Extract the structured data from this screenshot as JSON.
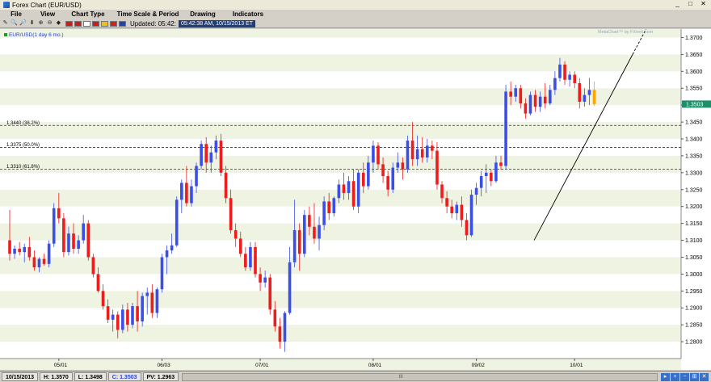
{
  "window": {
    "title": "Forex Chart (EUR/USD)",
    "buttons": [
      "_",
      "□",
      "✕"
    ]
  },
  "menu": [
    {
      "label": "File",
      "w": 40
    },
    {
      "label": "View",
      "w": 38
    },
    {
      "label": "Chart Type",
      "w": 62
    },
    {
      "label": "Time Scale & Period",
      "w": 86
    },
    {
      "label": "Drawing",
      "w": 50
    },
    {
      "label": "Indicators",
      "w": 62
    }
  ],
  "toolbar": {
    "tools": [
      "✎",
      "🔍",
      "🔎",
      "⬇",
      "⊕",
      "⊖",
      "◆"
    ],
    "flags": [
      "#c81e1e",
      "#c81e1e",
      "#ffffff",
      "#c81e1e",
      "#e8c020",
      "#d02020",
      "#2244aa"
    ],
    "updated_label": "Updated: 05:42:",
    "updated_value": "05:42:38 AM, 10/15/2013 ET"
  },
  "chart": {
    "symbol_label": "EUR/USD(1 day 6 mo.)",
    "watermark": "MetaChart™ by FXtrek.com",
    "current_price": "1.3503",
    "fib_lines": [
      {
        "label": "1.3440 (38.2%)",
        "price": 1.344
      },
      {
        "label": "1.3375 (50.0%)",
        "price": 1.3375
      },
      {
        "label": "1.3310 (61.8%)",
        "price": 1.331
      }
    ],
    "colors": {
      "up": "#3b4fe8",
      "down": "#ee1c1c",
      "last": "#ffa500",
      "band_light": "#ffffff",
      "band_dark": "#eef3e2",
      "badge": "#1f8f6b"
    }
  },
  "chart_data": {
    "type": "candlestick",
    "title": "EUR/USD(1 day 6 mo.)",
    "ylim": [
      1.275,
      1.3725
    ],
    "y_ticks": [
      "1.3700",
      "1.3650",
      "1.3600",
      "1.3550",
      "1.3500",
      "1.3450",
      "1.3400",
      "1.3350",
      "1.3300",
      "1.3250",
      "1.3200",
      "1.3150",
      "1.3100",
      "1.3050",
      "1.3000",
      "1.2950",
      "1.2900",
      "1.2850",
      "1.2800"
    ],
    "x_ticks": [
      {
        "label": "05/01",
        "index": 10
      },
      {
        "label": "06/03",
        "index": 31
      },
      {
        "label": "07/01",
        "index": 51
      },
      {
        "label": "08/01",
        "index": 74
      },
      {
        "label": "09/02",
        "index": 95
      },
      {
        "label": "10/01",
        "index": 115
      }
    ],
    "candles": [
      {
        "o": 1.31,
        "h": 1.319,
        "l": 1.304,
        "c": 1.306
      },
      {
        "o": 1.306,
        "h": 1.3085,
        "l": 1.3045,
        "c": 1.3075
      },
      {
        "o": 1.3075,
        "h": 1.3095,
        "l": 1.3055,
        "c": 1.3065
      },
      {
        "o": 1.3065,
        "h": 1.309,
        "l": 1.3035,
        "c": 1.308
      },
      {
        "o": 1.308,
        "h": 1.311,
        "l": 1.304,
        "c": 1.305
      },
      {
        "o": 1.305,
        "h": 1.307,
        "l": 1.301,
        "c": 1.302
      },
      {
        "o": 1.302,
        "h": 1.305,
        "l": 1.3005,
        "c": 1.3045
      },
      {
        "o": 1.3045,
        "h": 1.306,
        "l": 1.3025,
        "c": 1.303
      },
      {
        "o": 1.303,
        "h": 1.31,
        "l": 1.302,
        "c": 1.309
      },
      {
        "o": 1.309,
        "h": 1.321,
        "l": 1.308,
        "c": 1.3195
      },
      {
        "o": 1.3195,
        "h": 1.324,
        "l": 1.315,
        "c": 1.3165
      },
      {
        "o": 1.3165,
        "h": 1.318,
        "l": 1.305,
        "c": 1.3065
      },
      {
        "o": 1.3065,
        "h": 1.314,
        "l": 1.3055,
        "c": 1.312
      },
      {
        "o": 1.312,
        "h": 1.315,
        "l": 1.306,
        "c": 1.3075
      },
      {
        "o": 1.3075,
        "h": 1.3115,
        "l": 1.306,
        "c": 1.31
      },
      {
        "o": 1.31,
        "h": 1.3175,
        "l": 1.309,
        "c": 1.315
      },
      {
        "o": 1.315,
        "h": 1.316,
        "l": 1.304,
        "c": 1.305
      },
      {
        "o": 1.305,
        "h": 1.306,
        "l": 1.299,
        "c": 1.3
      },
      {
        "o": 1.3,
        "h": 1.302,
        "l": 1.2945,
        "c": 1.295
      },
      {
        "o": 1.295,
        "h": 1.297,
        "l": 1.2895,
        "c": 1.2905
      },
      {
        "o": 1.2905,
        "h": 1.2925,
        "l": 1.2855,
        "c": 1.2865
      },
      {
        "o": 1.2865,
        "h": 1.2895,
        "l": 1.283,
        "c": 1.288
      },
      {
        "o": 1.288,
        "h": 1.289,
        "l": 1.281,
        "c": 1.2835
      },
      {
        "o": 1.2835,
        "h": 1.291,
        "l": 1.2825,
        "c": 1.2895
      },
      {
        "o": 1.2895,
        "h": 1.2915,
        "l": 1.283,
        "c": 1.285
      },
      {
        "o": 1.285,
        "h": 1.2915,
        "l": 1.284,
        "c": 1.2905
      },
      {
        "o": 1.2905,
        "h": 1.295,
        "l": 1.283,
        "c": 1.286
      },
      {
        "o": 1.286,
        "h": 1.2945,
        "l": 1.2845,
        "c": 1.2935
      },
      {
        "o": 1.2935,
        "h": 1.296,
        "l": 1.288,
        "c": 1.2945
      },
      {
        "o": 1.2945,
        "h": 1.297,
        "l": 1.287,
        "c": 1.2885
      },
      {
        "o": 1.2885,
        "h": 1.296,
        "l": 1.287,
        "c": 1.2955
      },
      {
        "o": 1.2955,
        "h": 1.306,
        "l": 1.2945,
        "c": 1.305
      },
      {
        "o": 1.305,
        "h": 1.3085,
        "l": 1.3,
        "c": 1.307
      },
      {
        "o": 1.307,
        "h": 1.312,
        "l": 1.306,
        "c": 1.3085
      },
      {
        "o": 1.3085,
        "h": 1.323,
        "l": 1.308,
        "c": 1.322
      },
      {
        "o": 1.322,
        "h": 1.328,
        "l": 1.318,
        "c": 1.327
      },
      {
        "o": 1.327,
        "h": 1.332,
        "l": 1.32,
        "c": 1.321
      },
      {
        "o": 1.321,
        "h": 1.328,
        "l": 1.32,
        "c": 1.326
      },
      {
        "o": 1.326,
        "h": 1.333,
        "l": 1.324,
        "c": 1.332
      },
      {
        "o": 1.332,
        "h": 1.3395,
        "l": 1.331,
        "c": 1.3385
      },
      {
        "o": 1.3385,
        "h": 1.3405,
        "l": 1.33,
        "c": 1.333
      },
      {
        "o": 1.333,
        "h": 1.338,
        "l": 1.33,
        "c": 1.336
      },
      {
        "o": 1.336,
        "h": 1.341,
        "l": 1.334,
        "c": 1.3395
      },
      {
        "o": 1.3395,
        "h": 1.3415,
        "l": 1.329,
        "c": 1.33
      },
      {
        "o": 1.33,
        "h": 1.332,
        "l": 1.321,
        "c": 1.3225
      },
      {
        "o": 1.3225,
        "h": 1.325,
        "l": 1.312,
        "c": 1.313
      },
      {
        "o": 1.313,
        "h": 1.315,
        "l": 1.308,
        "c": 1.3105
      },
      {
        "o": 1.3105,
        "h": 1.3125,
        "l": 1.305,
        "c": 1.306
      },
      {
        "o": 1.306,
        "h": 1.308,
        "l": 1.301,
        "c": 1.302
      },
      {
        "o": 1.302,
        "h": 1.3095,
        "l": 1.301,
        "c": 1.308
      },
      {
        "o": 1.308,
        "h": 1.3095,
        "l": 1.299,
        "c": 1.3
      },
      {
        "o": 1.3,
        "h": 1.302,
        "l": 1.295,
        "c": 1.2975
      },
      {
        "o": 1.2975,
        "h": 1.301,
        "l": 1.296,
        "c": 1.299
      },
      {
        "o": 1.299,
        "h": 1.3,
        "l": 1.288,
        "c": 1.2895
      },
      {
        "o": 1.2895,
        "h": 1.292,
        "l": 1.283,
        "c": 1.2845
      },
      {
        "o": 1.2845,
        "h": 1.287,
        "l": 1.278,
        "c": 1.28
      },
      {
        "o": 1.28,
        "h": 1.289,
        "l": 1.277,
        "c": 1.2885
      },
      {
        "o": 1.2885,
        "h": 1.308,
        "l": 1.288,
        "c": 1.3035
      },
      {
        "o": 1.3035,
        "h": 1.322,
        "l": 1.302,
        "c": 1.313
      },
      {
        "o": 1.313,
        "h": 1.315,
        "l": 1.301,
        "c": 1.306
      },
      {
        "o": 1.306,
        "h": 1.319,
        "l": 1.305,
        "c": 1.3175
      },
      {
        "o": 1.3175,
        "h": 1.32,
        "l": 1.3115,
        "c": 1.314
      },
      {
        "o": 1.314,
        "h": 1.321,
        "l": 1.309,
        "c": 1.3105
      },
      {
        "o": 1.3105,
        "h": 1.317,
        "l": 1.307,
        "c": 1.3145
      },
      {
        "o": 1.3145,
        "h": 1.323,
        "l": 1.313,
        "c": 1.3215
      },
      {
        "o": 1.3215,
        "h": 1.324,
        "l": 1.316,
        "c": 1.318
      },
      {
        "o": 1.318,
        "h": 1.323,
        "l": 1.317,
        "c": 1.3225
      },
      {
        "o": 1.3225,
        "h": 1.328,
        "l": 1.321,
        "c": 1.3265
      },
      {
        "o": 1.3265,
        "h": 1.33,
        "l": 1.322,
        "c": 1.324
      },
      {
        "o": 1.324,
        "h": 1.329,
        "l": 1.322,
        "c": 1.3275
      },
      {
        "o": 1.3275,
        "h": 1.331,
        "l": 1.319,
        "c": 1.32
      },
      {
        "o": 1.32,
        "h": 1.331,
        "l": 1.318,
        "c": 1.33
      },
      {
        "o": 1.33,
        "h": 1.333,
        "l": 1.324,
        "c": 1.326
      },
      {
        "o": 1.326,
        "h": 1.335,
        "l": 1.325,
        "c": 1.333
      },
      {
        "o": 1.333,
        "h": 1.3395,
        "l": 1.33,
        "c": 1.338
      },
      {
        "o": 1.338,
        "h": 1.339,
        "l": 1.331,
        "c": 1.3325
      },
      {
        "o": 1.3325,
        "h": 1.3345,
        "l": 1.327,
        "c": 1.329
      },
      {
        "o": 1.329,
        "h": 1.3305,
        "l": 1.323,
        "c": 1.325
      },
      {
        "o": 1.325,
        "h": 1.333,
        "l": 1.324,
        "c": 1.3315
      },
      {
        "o": 1.3315,
        "h": 1.336,
        "l": 1.33,
        "c": 1.333
      },
      {
        "o": 1.333,
        "h": 1.3345,
        "l": 1.328,
        "c": 1.331
      },
      {
        "o": 1.331,
        "h": 1.341,
        "l": 1.33,
        "c": 1.3395
      },
      {
        "o": 1.3395,
        "h": 1.345,
        "l": 1.332,
        "c": 1.334
      },
      {
        "o": 1.334,
        "h": 1.341,
        "l": 1.332,
        "c": 1.337
      },
      {
        "o": 1.337,
        "h": 1.3405,
        "l": 1.333,
        "c": 1.3345
      },
      {
        "o": 1.3345,
        "h": 1.34,
        "l": 1.333,
        "c": 1.338
      },
      {
        "o": 1.338,
        "h": 1.3395,
        "l": 1.334,
        "c": 1.3365
      },
      {
        "o": 1.3365,
        "h": 1.339,
        "l": 1.325,
        "c": 1.3265
      },
      {
        "o": 1.3265,
        "h": 1.3275,
        "l": 1.321,
        "c": 1.3225
      },
      {
        "o": 1.3225,
        "h": 1.3245,
        "l": 1.318,
        "c": 1.32
      },
      {
        "o": 1.32,
        "h": 1.322,
        "l": 1.3165,
        "c": 1.318
      },
      {
        "o": 1.318,
        "h": 1.3215,
        "l": 1.316,
        "c": 1.3205
      },
      {
        "o": 1.3205,
        "h": 1.323,
        "l": 1.314,
        "c": 1.316
      },
      {
        "o": 1.316,
        "h": 1.318,
        "l": 1.31,
        "c": 1.3115
      },
      {
        "o": 1.3115,
        "h": 1.325,
        "l": 1.311,
        "c": 1.3235
      },
      {
        "o": 1.3235,
        "h": 1.327,
        "l": 1.3205,
        "c": 1.3255
      },
      {
        "o": 1.3255,
        "h": 1.3305,
        "l": 1.323,
        "c": 1.329
      },
      {
        "o": 1.329,
        "h": 1.3325,
        "l": 1.324,
        "c": 1.33
      },
      {
        "o": 1.33,
        "h": 1.331,
        "l": 1.326,
        "c": 1.3275
      },
      {
        "o": 1.3275,
        "h": 1.335,
        "l": 1.327,
        "c": 1.333
      },
      {
        "o": 1.333,
        "h": 1.335,
        "l": 1.331,
        "c": 1.332
      },
      {
        "o": 1.332,
        "h": 1.356,
        "l": 1.331,
        "c": 1.354
      },
      {
        "o": 1.354,
        "h": 1.357,
        "l": 1.35,
        "c": 1.3525
      },
      {
        "o": 1.3525,
        "h": 1.356,
        "l": 1.351,
        "c": 1.355
      },
      {
        "o": 1.355,
        "h": 1.356,
        "l": 1.349,
        "c": 1.3505
      },
      {
        "o": 1.3505,
        "h": 1.352,
        "l": 1.346,
        "c": 1.3475
      },
      {
        "o": 1.3475,
        "h": 1.354,
        "l": 1.347,
        "c": 1.353
      },
      {
        "o": 1.353,
        "h": 1.3545,
        "l": 1.348,
        "c": 1.3495
      },
      {
        "o": 1.3495,
        "h": 1.354,
        "l": 1.348,
        "c": 1.3525
      },
      {
        "o": 1.3525,
        "h": 1.3565,
        "l": 1.349,
        "c": 1.3505
      },
      {
        "o": 1.3505,
        "h": 1.356,
        "l": 1.35,
        "c": 1.3545
      },
      {
        "o": 1.3545,
        "h": 1.36,
        "l": 1.353,
        "c": 1.358
      },
      {
        "o": 1.358,
        "h": 1.364,
        "l": 1.357,
        "c": 1.362
      },
      {
        "o": 1.362,
        "h": 1.363,
        "l": 1.356,
        "c": 1.3575
      },
      {
        "o": 1.3575,
        "h": 1.36,
        "l": 1.3555,
        "c": 1.359
      },
      {
        "o": 1.359,
        "h": 1.36,
        "l": 1.355,
        "c": 1.3565
      },
      {
        "o": 1.3565,
        "h": 1.358,
        "l": 1.349,
        "c": 1.351
      },
      {
        "o": 1.351,
        "h": 1.355,
        "l": 1.3495,
        "c": 1.353
      },
      {
        "o": 1.353,
        "h": 1.358,
        "l": 1.35,
        "c": 1.3545
      },
      {
        "o": 1.3545,
        "h": 1.357,
        "l": 1.3498,
        "c": 1.3503
      }
    ]
  },
  "status": {
    "date": "10/15/2013",
    "high": "H: 1.3570",
    "low": "L: 1.3498",
    "close": "C: 1.3503",
    "pv": "PV: 1.2963",
    "scroll_grip": "III",
    "zoom_buttons": [
      "▸",
      "+",
      "−",
      "⊞",
      "✕"
    ]
  }
}
